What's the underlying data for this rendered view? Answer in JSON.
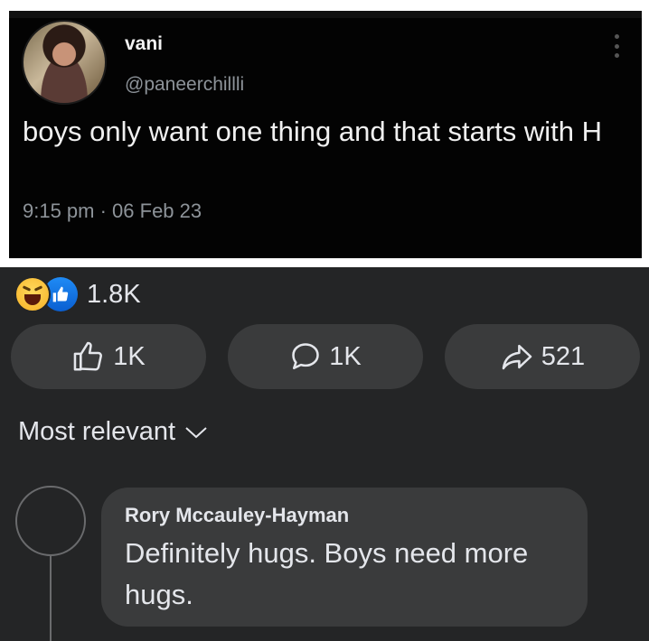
{
  "tweet": {
    "author_name": "vani",
    "author_handle": "@paneerchillli",
    "text": "boys only want one thing and that starts with H",
    "timestamp": "9:15 pm · 06 Feb 23"
  },
  "post_stats": {
    "reaction_count": "1.8K",
    "reaction_icons": [
      "haha-emoji",
      "like-emoji"
    ]
  },
  "actions": {
    "like_count": "1K",
    "comment_count": "1K",
    "share_count": "521"
  },
  "comments": {
    "sort_label": "Most relevant",
    "items": [
      {
        "author": "Rory Mccauley-Hayman",
        "text": "Definitely hugs. Boys need more hugs."
      }
    ]
  },
  "colors": {
    "background": "#242526",
    "button": "#3a3b3c",
    "text": "#e4e6eb",
    "like_blue": "#1877f2",
    "haha_yellow": "#f7b125"
  }
}
